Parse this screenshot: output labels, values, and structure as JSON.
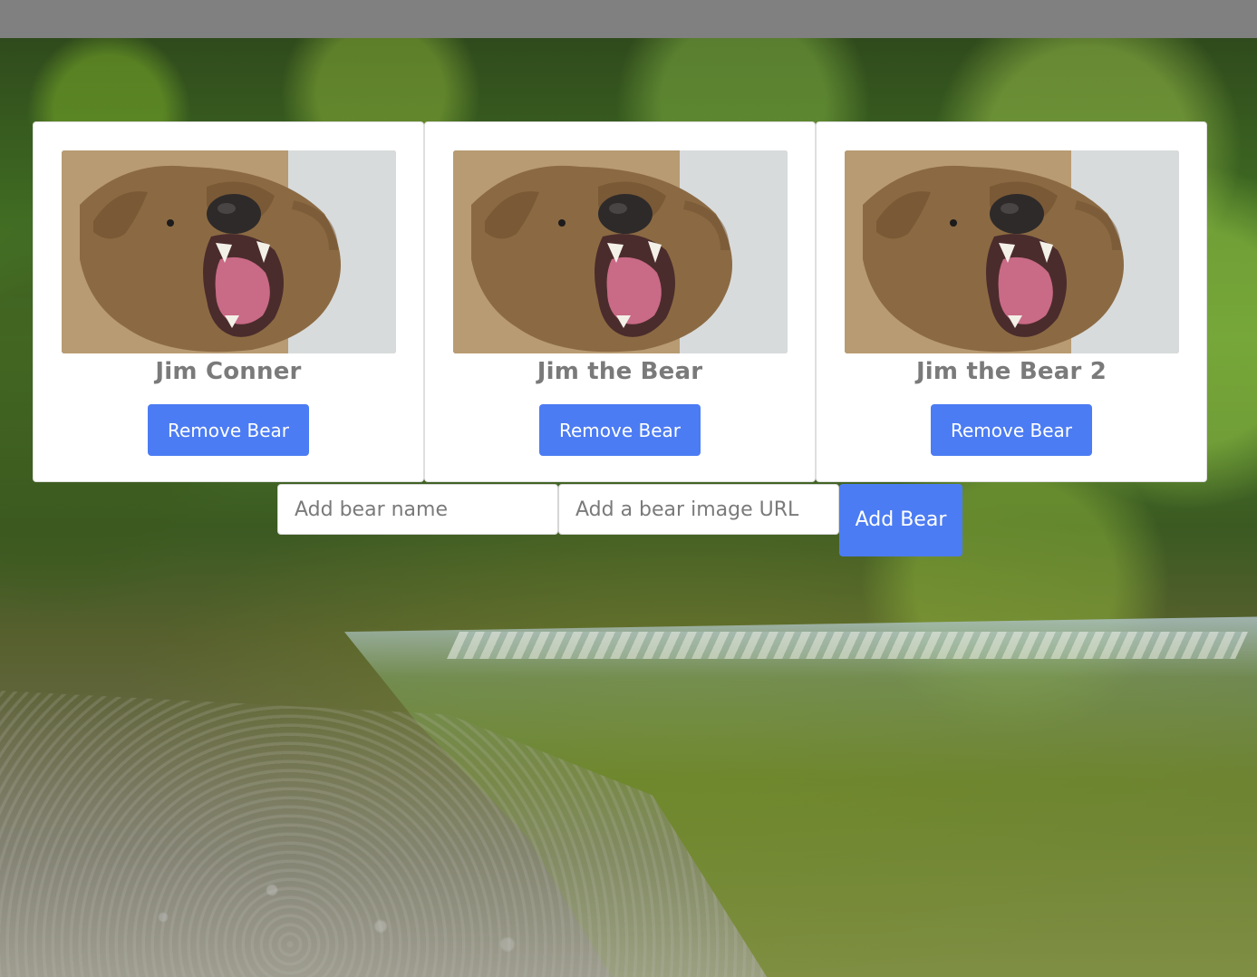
{
  "bears": [
    {
      "name": "Jim Conner",
      "remove_label": "Remove Bear"
    },
    {
      "name": "Jim the Bear",
      "remove_label": "Remove Bear"
    },
    {
      "name": "Jim the Bear 2",
      "remove_label": "Remove Bear"
    }
  ],
  "form": {
    "name_placeholder": "Add bear name",
    "url_placeholder": "Add a bear image URL",
    "add_label": "Add Bear"
  },
  "colors": {
    "primary_button": "#4c7cf3",
    "card_text": "#7a7a7a",
    "top_bar": "#808080"
  }
}
